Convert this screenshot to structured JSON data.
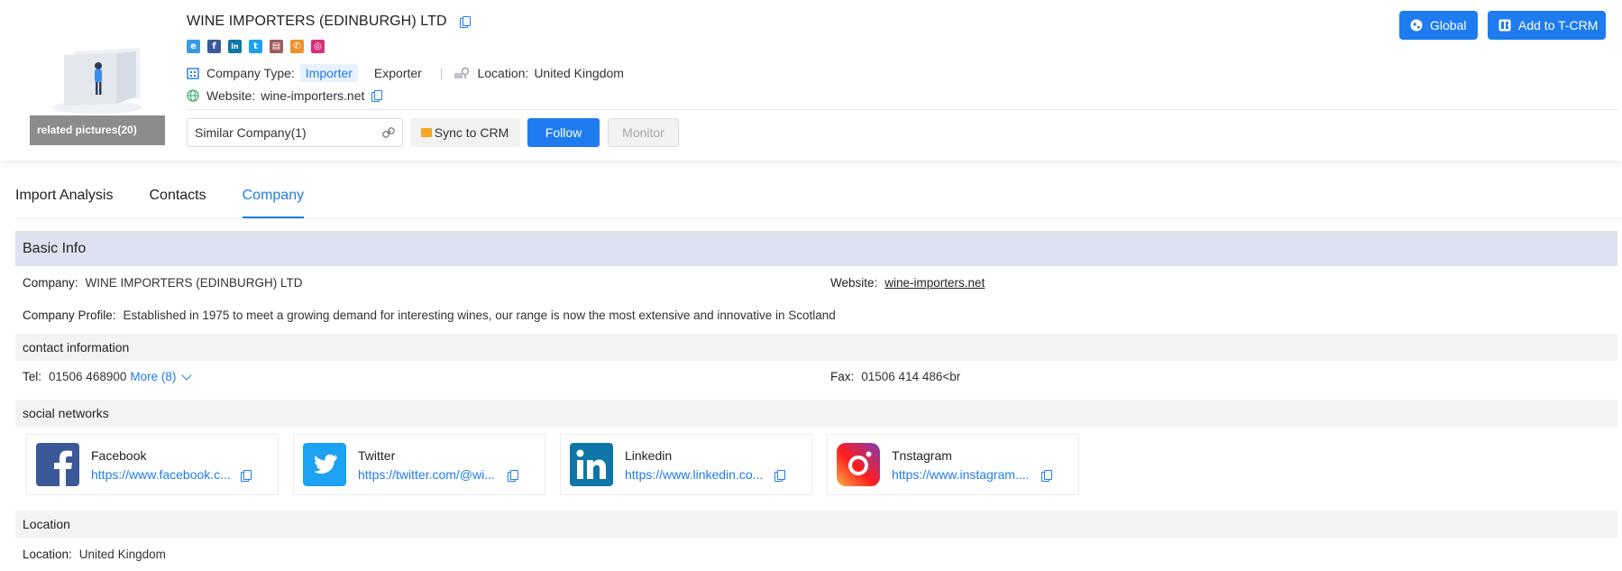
{
  "header": {
    "company_name": "WINE IMPORTERS (EDINBURGH) LTD",
    "related_pictures": "related pictures(20)",
    "social_icons": [
      "ie-icon",
      "facebook-icon",
      "linkedin-icon",
      "twitter-icon",
      "fax-icon",
      "phone-icon",
      "instagram-icon"
    ],
    "company_type_label": "Company Type:",
    "type_importer": "Importer",
    "type_exporter": "Exporter",
    "location_label": "Location:",
    "location_value": "United Kingdom",
    "website_label": "Website:",
    "website_value": "wine-importers.net",
    "similar_company": "Similar Company(1)",
    "sync_label": "Sync to CRM",
    "follow_label": "Follow",
    "monitor_label": "Monitor",
    "global_label": "Global",
    "add_tcrm_label": "Add to T-CRM"
  },
  "tabs": [
    {
      "label": "Import Analysis",
      "active": false
    },
    {
      "label": "Contacts",
      "active": false
    },
    {
      "label": "Company",
      "active": true
    }
  ],
  "basic_info": {
    "title": "Basic Info",
    "company_label": "Company:",
    "company_value": "WINE IMPORTERS (EDINBURGH) LTD",
    "website_label": "Website:",
    "website_value": "wine-importers.net",
    "profile_label": "Company Profile:",
    "profile_value": "Established in 1975 to meet a growing demand for interesting wines, our range is now the most extensive and innovative in Scotland"
  },
  "contact_info": {
    "title": "contact information",
    "tel_label": "Tel:",
    "tel_value": "01506 468900",
    "more_label": "More  (8)",
    "fax_label": "Fax:",
    "fax_value": "01506 414 486<br"
  },
  "social_networks": {
    "title": "social networks",
    "items": [
      {
        "name": "Facebook",
        "url": "https://www.facebook.c...",
        "icon": "facebook-icon",
        "color": "#3b5998"
      },
      {
        "name": "Twitter",
        "url": "https://twitter.com/@wi...",
        "icon": "twitter-icon",
        "color": "#1da1f2"
      },
      {
        "name": "Linkedin",
        "url": "https://www.linkedin.co...",
        "icon": "linkedin-icon",
        "color": "#0e76a8"
      },
      {
        "name": "Tnstagram",
        "url": "https://www.instagram....",
        "icon": "instagram-icon",
        "color": "#e1306c"
      }
    ]
  },
  "location": {
    "title": "Location",
    "label": "Location:",
    "value": "United Kingdom"
  },
  "colors": {
    "accent": "#1f7cf0",
    "section_bg": "#dde2f0",
    "subsection_bg": "#f3f3f5"
  }
}
